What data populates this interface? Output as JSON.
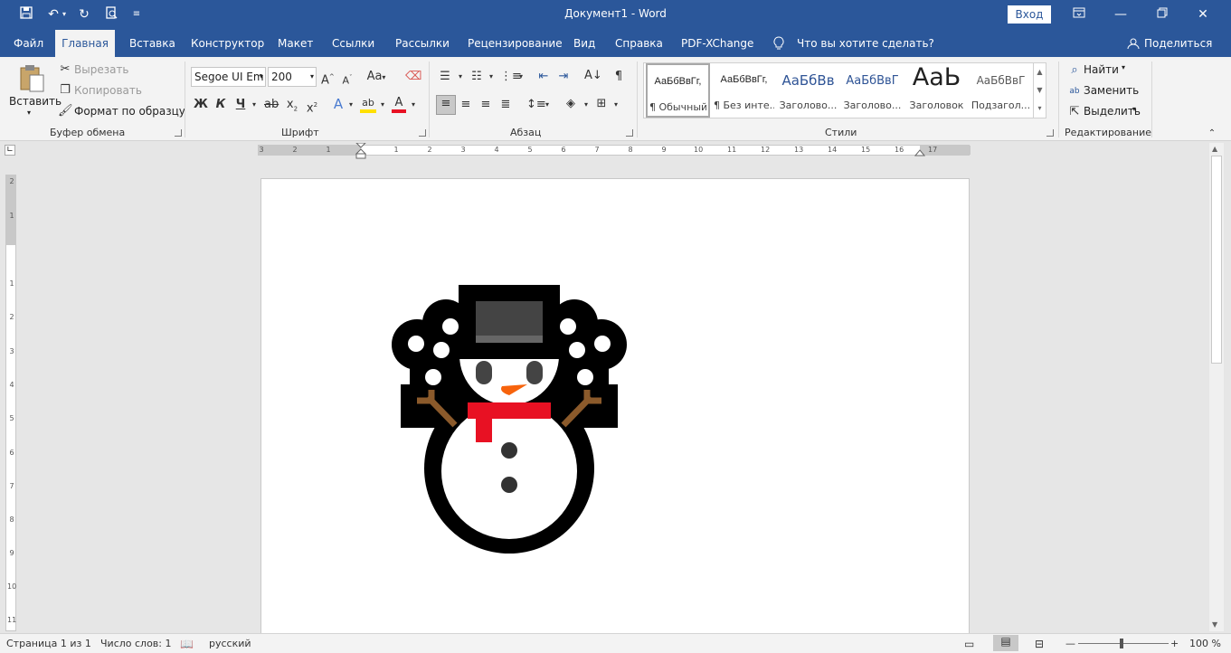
{
  "window": {
    "title": "Документ1 - Word",
    "sign_in": "Вход"
  },
  "tabs": [
    "Файл",
    "Главная",
    "Вставка",
    "Конструктор",
    "Макет",
    "Ссылки",
    "Рассылки",
    "Рецензирование",
    "Вид",
    "Справка",
    "PDF-XChange"
  ],
  "tell_me": "Что вы хотите сделать?",
  "share": "Поделиться",
  "clipboard": {
    "paste": "Вставить",
    "cut": "Вырезать",
    "copy": "Копировать",
    "format_painter": "Формат по образцу",
    "group": "Буфер обмена"
  },
  "font": {
    "name": "Segoe UI Em",
    "size": "200",
    "bold": "Ж",
    "italic": "К",
    "underline": "Ч",
    "group": "Шрифт"
  },
  "paragraph": {
    "group": "Абзац"
  },
  "styles": {
    "group": "Стили",
    "items": [
      {
        "preview": "АаБбВвГг,",
        "name": "¶ Обычный"
      },
      {
        "preview": "АаБбВвГг,",
        "name": "¶ Без инте..."
      },
      {
        "preview": "АаБбВв",
        "name": "Заголово..."
      },
      {
        "preview": "АаБбВвГ",
        "name": "Заголово..."
      },
      {
        "preview": "АаЬ",
        "name": "Заголовок"
      },
      {
        "preview": "АаБбВвГ",
        "name": "Подзагол..."
      }
    ]
  },
  "editing": {
    "find": "Найти",
    "replace": "Заменить",
    "select": "Выделить",
    "group": "Редактирование"
  },
  "ruler": {
    "h_numbers": [
      "3",
      "2",
      "1",
      "1",
      "2",
      "3",
      "4",
      "5",
      "6",
      "7",
      "8",
      "9",
      "10",
      "11",
      "12",
      "13",
      "14",
      "15",
      "16",
      "17"
    ],
    "v_numbers": [
      "2",
      "1",
      "1",
      "2",
      "3",
      "4",
      "5",
      "6",
      "7",
      "8",
      "9",
      "10",
      "11"
    ]
  },
  "status": {
    "page": "Страница 1 из 1",
    "words": "Число слов: 1",
    "language": "русский",
    "zoom": "100 %"
  },
  "colors": {
    "accent": "#2b579a",
    "snowman_scarf": "#e81123",
    "snowman_nose": "#f7630c",
    "snowman_arms": "#8b5a2b"
  }
}
